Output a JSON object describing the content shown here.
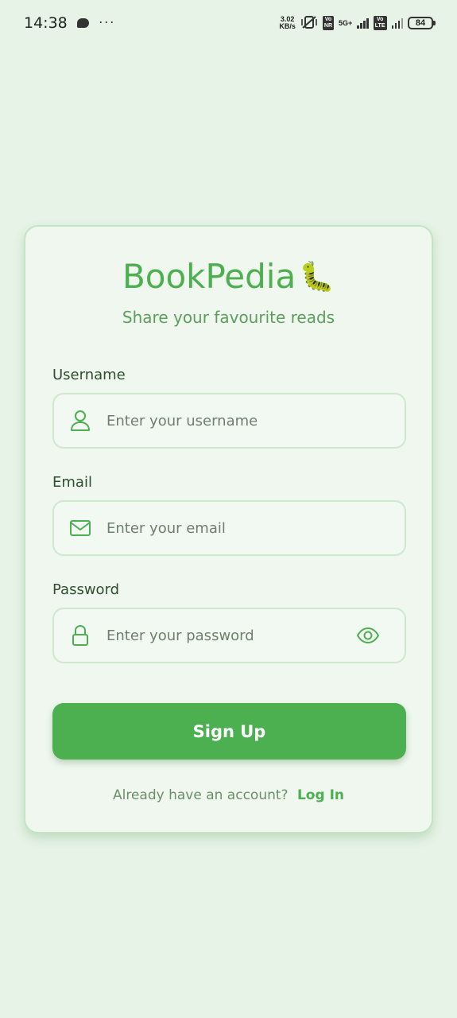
{
  "status_bar": {
    "time": "14:38",
    "dots": "···",
    "speed_value": "3.02",
    "speed_unit": "KB/s",
    "vo_nr_top": "Vo",
    "vo_nr_bottom": "NR",
    "net_5g": "5G+",
    "vo_lte_top": "Vo",
    "vo_lte_bottom": "LTE",
    "battery": "84"
  },
  "app": {
    "title": "BookPedia",
    "emoji": "🐛",
    "tagline": "Share your favourite reads"
  },
  "form": {
    "username_label": "Username",
    "username_placeholder": "Enter your username",
    "email_label": "Email",
    "email_placeholder": "Enter your email",
    "password_label": "Password",
    "password_placeholder": "Enter your password",
    "submit_label": "Sign Up"
  },
  "footer": {
    "prompt": "Already have an account?",
    "login_link": "Log In"
  },
  "colors": {
    "background": "#e6f3e6",
    "accent": "#4caf50",
    "card": "#eff7ef"
  }
}
